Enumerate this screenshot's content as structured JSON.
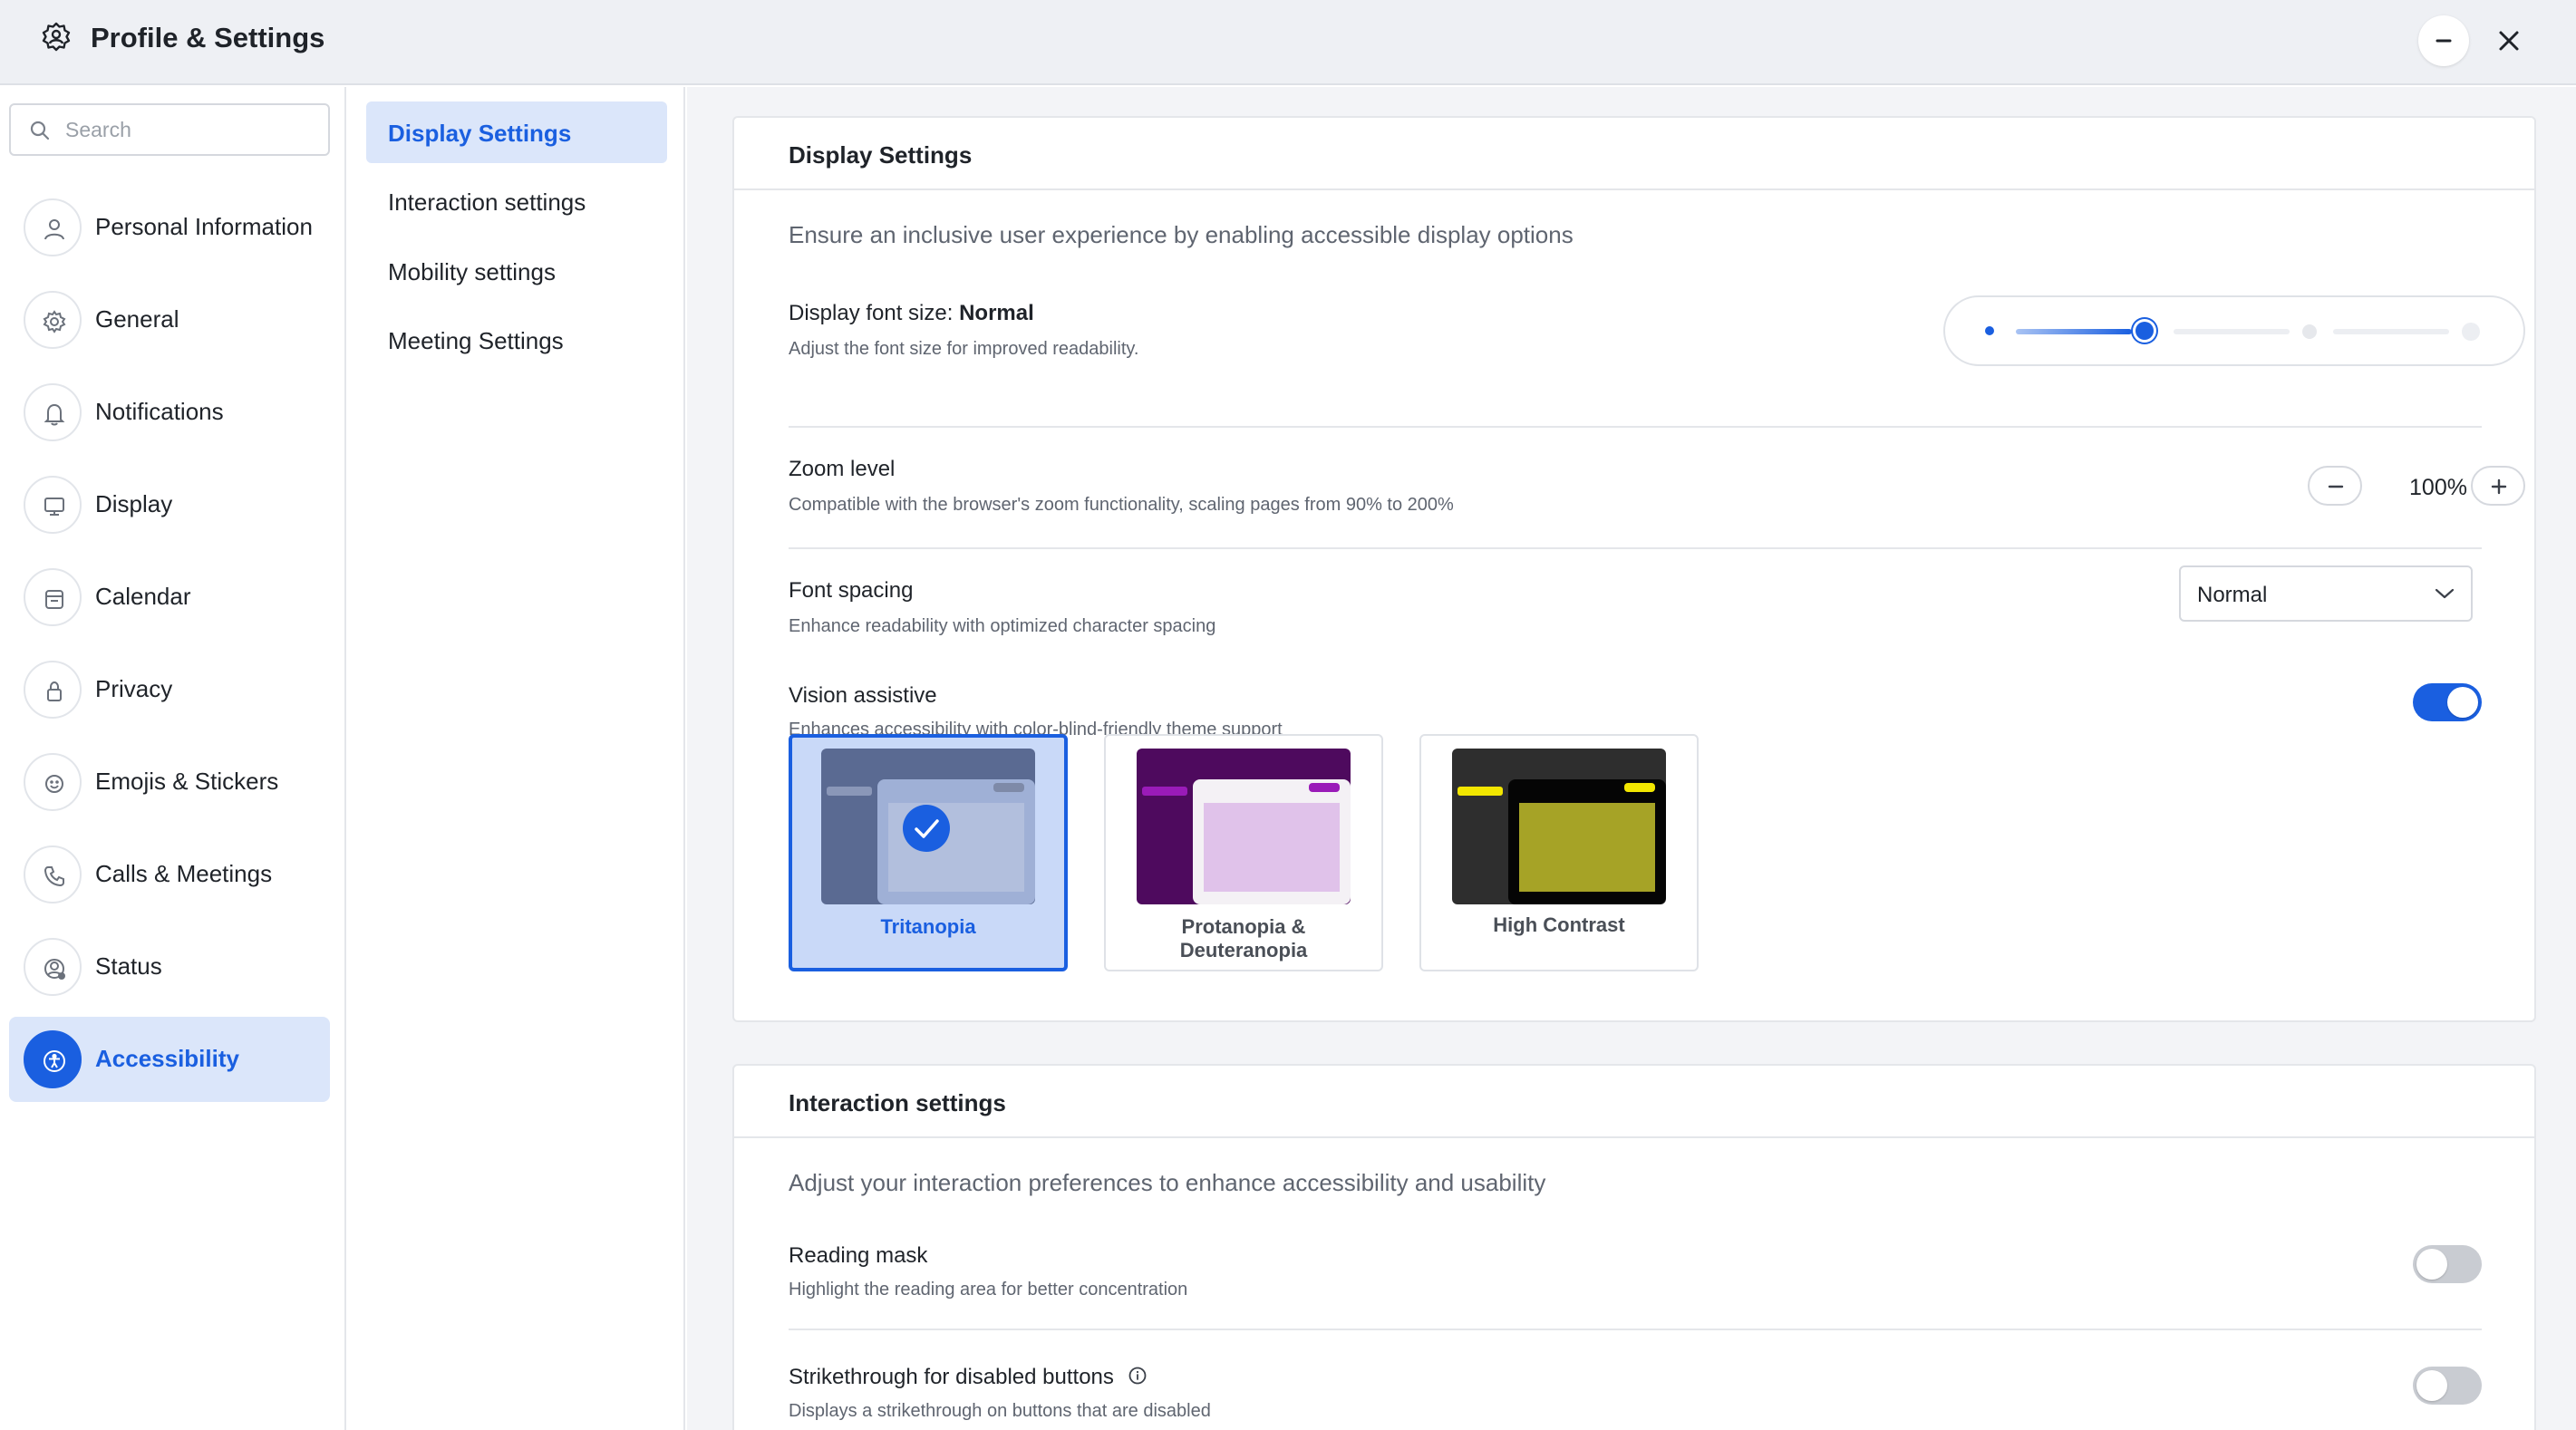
{
  "window": {
    "title": "Profile & Settings",
    "icon": "gear-icon"
  },
  "search": {
    "placeholder": "Search",
    "value": ""
  },
  "sidebar": {
    "items": [
      {
        "label": "Personal Information",
        "icon": "user-icon"
      },
      {
        "label": "General",
        "icon": "gear-icon"
      },
      {
        "label": "Notifications",
        "icon": "bell-icon"
      },
      {
        "label": "Display",
        "icon": "monitor-icon"
      },
      {
        "label": "Calendar",
        "icon": "calendar-icon"
      },
      {
        "label": "Privacy",
        "icon": "lock-icon"
      },
      {
        "label": "Emojis & Stickers",
        "icon": "smiley-icon"
      },
      {
        "label": "Calls & Meetings",
        "icon": "phone-icon"
      },
      {
        "label": "Status",
        "icon": "user-status-icon"
      },
      {
        "label": "Accessibility",
        "icon": "accessibility-icon",
        "active": true
      }
    ]
  },
  "subnav": {
    "items": [
      {
        "label": "Display Settings",
        "active": true
      },
      {
        "label": "Interaction settings"
      },
      {
        "label": "Mobility settings"
      },
      {
        "label": "Meeting Settings"
      }
    ]
  },
  "display_settings": {
    "header": "Display Settings",
    "description": "Ensure an inclusive user experience by enabling accessible display options",
    "font_size": {
      "title_prefix": "Display font size: ",
      "value": "Normal",
      "subtitle": "Adjust the font size for improved readability.",
      "level_index": 1,
      "level_count": 4
    },
    "zoom": {
      "title": "Zoom level",
      "subtitle": "Compatible with the browser's zoom functionality, scaling pages from 90% to 200%",
      "value": "100%"
    },
    "font_spacing": {
      "title": "Font spacing",
      "subtitle": "Enhance readability with optimized character spacing",
      "selected": "Normal"
    },
    "vision": {
      "title": "Vision assistive",
      "subtitle": "Enhances accessibility with color-blind-friendly theme support",
      "enabled": true,
      "themes": [
        {
          "label": "Tritanopia",
          "selected": true
        },
        {
          "label": "Protanopia & Deuteranopia",
          "label_line1": "Protanopia &",
          "label_line2": "Deuteranopia"
        },
        {
          "label": "High Contrast"
        }
      ]
    }
  },
  "interaction_settings": {
    "header": "Interaction settings",
    "description": "Adjust your interaction preferences to enhance accessibility and usability",
    "reading_mask": {
      "title": "Reading mask",
      "subtitle": "Highlight the reading area for better concentration",
      "enabled": false
    },
    "strikethrough": {
      "title": "Strikethrough for disabled buttons",
      "subtitle": "Displays a strikethrough on buttons that are disabled",
      "enabled": false
    }
  },
  "colors": {
    "accent": "#1a5fe0",
    "active_bg": "#dbe6fa",
    "panel_bg": "#f3f4f7"
  }
}
